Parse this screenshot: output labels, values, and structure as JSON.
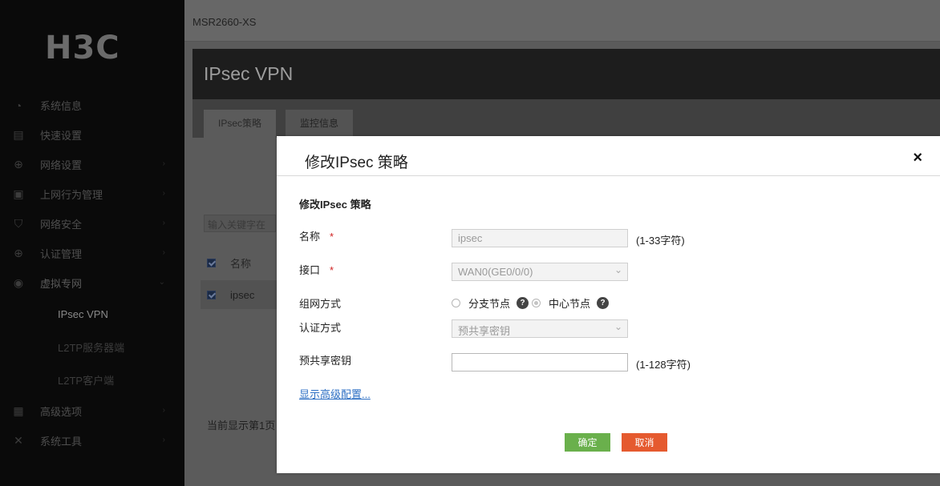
{
  "sidebar": {
    "logo": "H3C",
    "items": [
      {
        "label": "系统信息",
        "icon": "gauge-icon",
        "has_children": false
      },
      {
        "label": "快速设置",
        "icon": "document-icon",
        "has_children": false
      },
      {
        "label": "网络设置",
        "icon": "globe-icon",
        "has_children": true
      },
      {
        "label": "上网行为管理",
        "icon": "clipboard-icon",
        "has_children": true
      },
      {
        "label": "网络安全",
        "icon": "shield-icon",
        "has_children": true
      },
      {
        "label": "认证管理",
        "icon": "globe-lock-icon",
        "has_children": true
      },
      {
        "label": "虚拟专网",
        "icon": "vpn-globe-icon",
        "has_children": true
      },
      {
        "label": "高级选项",
        "icon": "grid-icon",
        "has_children": true
      },
      {
        "label": "系统工具",
        "icon": "tools-icon",
        "has_children": true
      }
    ],
    "vpn_subitems": [
      "IPsec VPN",
      "L2TP服务器端",
      "L2TP客户端"
    ]
  },
  "topbar": {
    "device": "MSR2660-XS"
  },
  "page": {
    "title": "IPsec VPN",
    "tabs": [
      "IPsec策略",
      "监控信息"
    ],
    "search_placeholder": "输入关键字在",
    "table": {
      "header": "名称",
      "rows": [
        "ipsec"
      ]
    },
    "status": "当前显示第1页"
  },
  "modal": {
    "title": "修改IPsec 策略",
    "close": "×",
    "section": "修改IPsec 策略",
    "name": {
      "label": "名称",
      "required": "*",
      "value": "ipsec",
      "hint": "(1-33字符)"
    },
    "interface": {
      "label": "接口",
      "required": "*",
      "value": "WAN0(GE0/0/0)"
    },
    "network_mode": {
      "label": "组网方式",
      "options": [
        "分支节点",
        "中心节点"
      ],
      "selected": "中心节点",
      "help": "?"
    },
    "auth_mode": {
      "label": "认证方式",
      "value": "预共享密钥"
    },
    "psk": {
      "label": "预共享密钥",
      "value": "",
      "hint": "(1-128字符)"
    },
    "advanced_link": "显示高级配置...",
    "ok": "确定",
    "cancel": "取消"
  },
  "colors": {
    "ok": "#6ab04c",
    "cancel": "#e55a2f",
    "link": "#2d6fc4",
    "required": "#d02020"
  }
}
